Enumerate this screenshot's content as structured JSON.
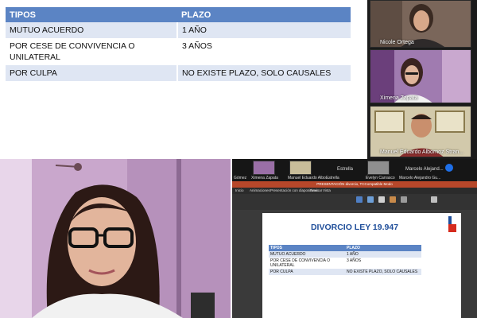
{
  "slide_table": {
    "headers": [
      "TIPOS",
      "PLAZO"
    ],
    "rows": [
      [
        "MUTUO ACUERDO",
        "1 AÑO"
      ],
      [
        "POR CESE DE CONVIVENCIA O UNILATERAL",
        "3 AÑOS"
      ],
      [
        "POR CULPA",
        "NO EXISTE PLAZO, SOLO CAUSALES"
      ]
    ]
  },
  "gallery": {
    "participants": [
      {
        "name": "Nicole Ortega"
      },
      {
        "name": "Ximena Zapata"
      },
      {
        "name": "Manuel Eduardo Albornoz Stran..."
      }
    ]
  },
  "shared_screen": {
    "strip_names": [
      "Gómez",
      "Ximena Zapata",
      "Manuel Eduardo Albo...",
      "Estrella",
      "Evelyn Carrasco",
      "Marcelo Alejand...",
      "Marcelo Alejandro Gu..."
    ],
    "strip_labels": [
      "Estrella",
      "Marcelo Alejand..."
    ],
    "pp_title": "PRESENTACIÓN divorcio, TCCompatible Modo",
    "pp_menu": [
      "Inicio",
      "Animaciones",
      "Presentación con diapositivas",
      "Revisar",
      "Vista"
    ],
    "slide_title": "DIVORCIO LEY 19.947",
    "colors": {
      "accent": "#5b84c4",
      "title": "#1f4e9a",
      "ppt_red": "#b7472a"
    }
  }
}
